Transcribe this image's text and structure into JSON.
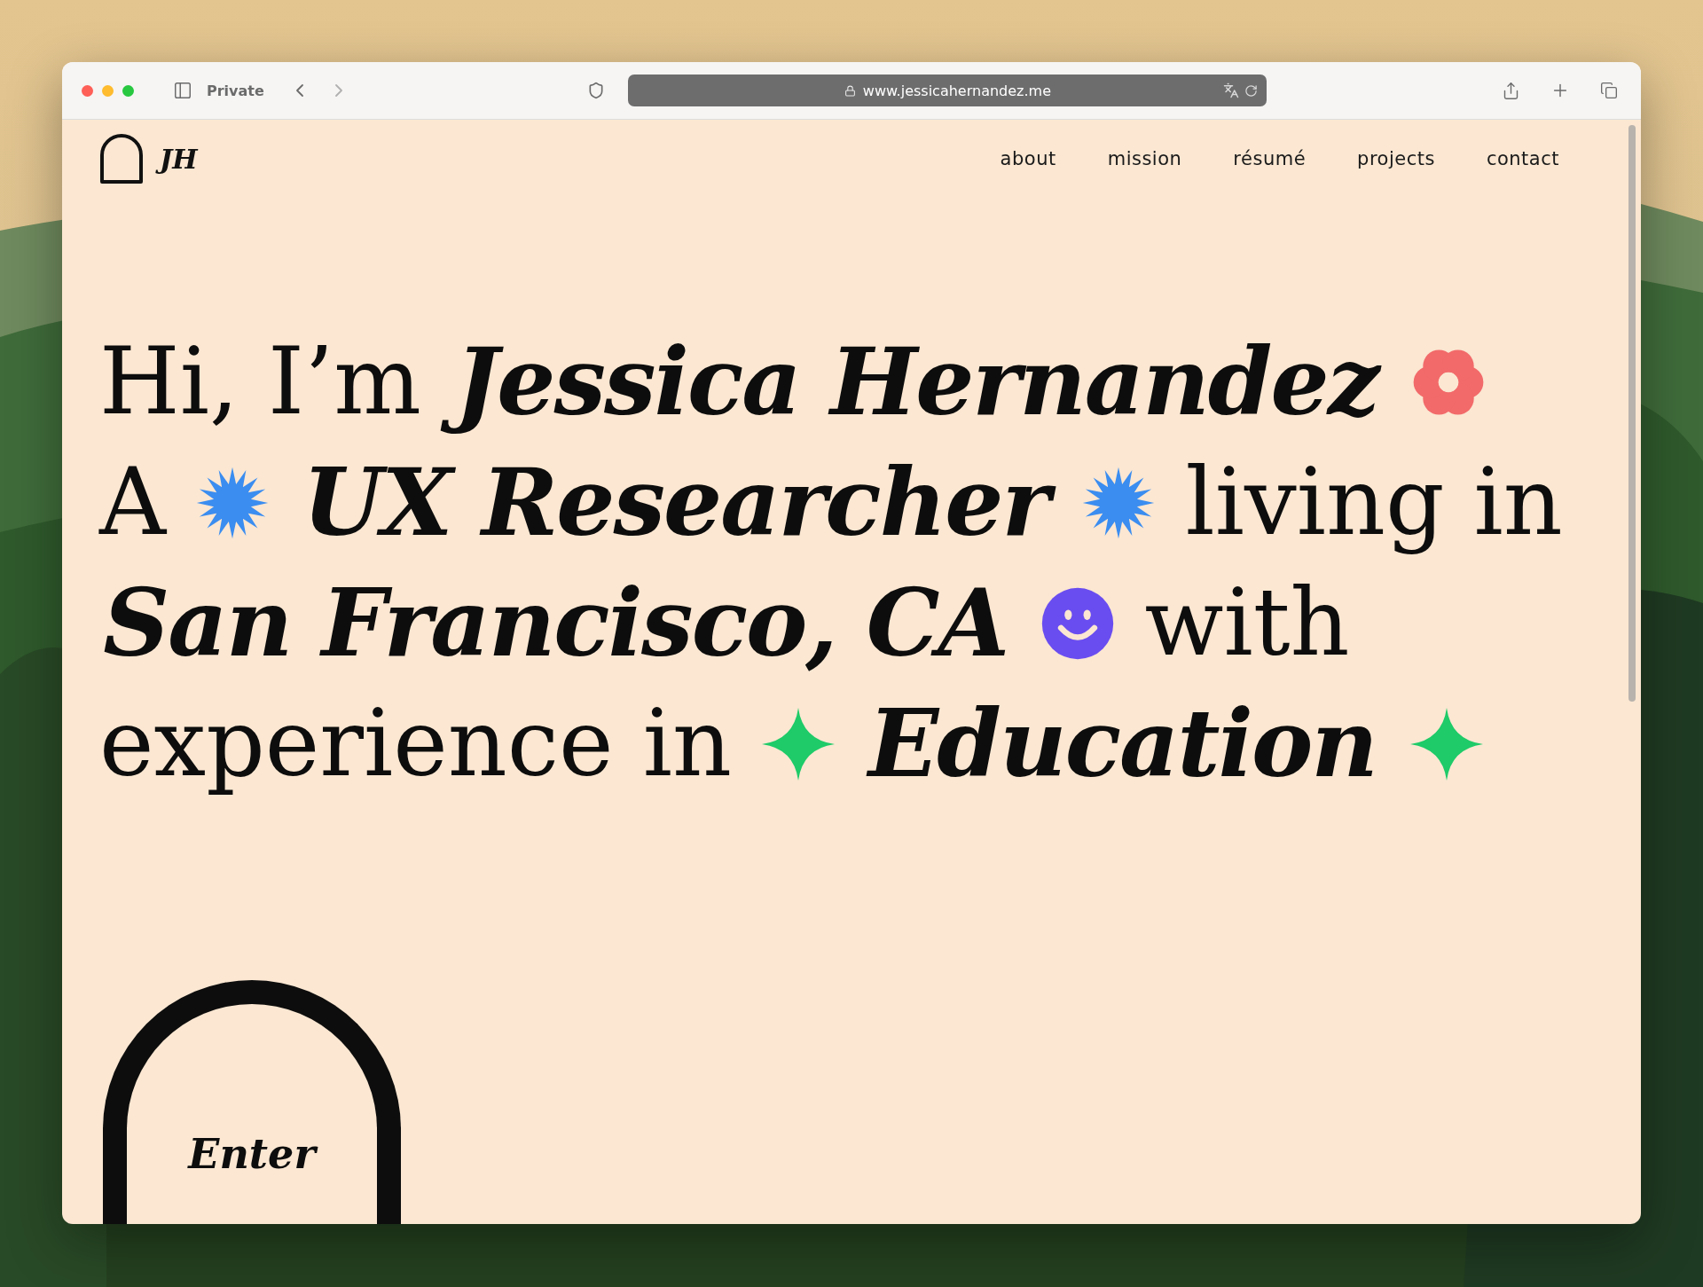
{
  "browser": {
    "private_label": "Private",
    "url": "www.jessicahernandez.me"
  },
  "site": {
    "logo": "JH",
    "nav": [
      {
        "label": "about"
      },
      {
        "label": "mission"
      },
      {
        "label": "résumé"
      },
      {
        "label": "projects"
      },
      {
        "label": "contact"
      }
    ],
    "headline": [
      [
        {
          "kind": "text",
          "text": "Hi, I’m"
        },
        {
          "kind": "emphasis",
          "text": "Jessica Hernandez"
        },
        {
          "kind": "flower",
          "color": "#f26a6a"
        }
      ],
      [
        {
          "kind": "text",
          "text": "A"
        },
        {
          "kind": "starburst",
          "color": "#3b8df0"
        },
        {
          "kind": "emphasis",
          "text": "UX Researcher"
        },
        {
          "kind": "starburst",
          "color": "#3b8df0"
        },
        {
          "kind": "text",
          "text": "living in"
        }
      ],
      [
        {
          "kind": "emphasis",
          "text": "San Francisco, CA"
        },
        {
          "kind": "smiley",
          "color": "#6a4df0"
        },
        {
          "kind": "text",
          "text": "with"
        }
      ],
      [
        {
          "kind": "text",
          "text": "experience in"
        },
        {
          "kind": "sparkle",
          "color": "#1ecb68"
        },
        {
          "kind": "emphasis",
          "text": "Education"
        },
        {
          "kind": "sparkle",
          "color": "#1ecb68"
        }
      ]
    ],
    "enter_button": "Enter"
  }
}
